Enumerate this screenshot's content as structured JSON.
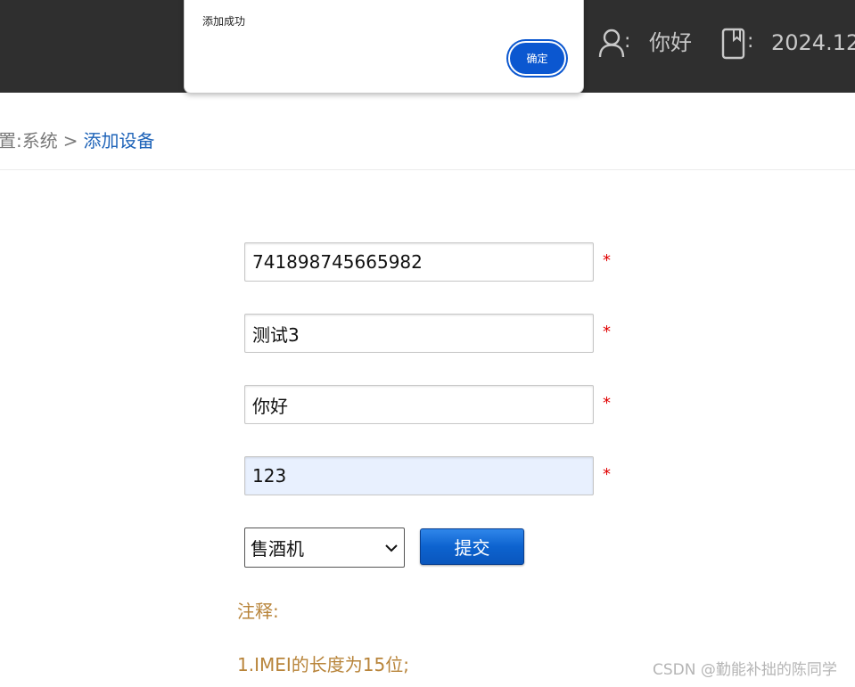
{
  "header": {
    "user_name": "你好",
    "date": "2024.12",
    "colon": ":",
    "user_icon": "user-icon",
    "book_icon": "book-icon",
    "background": "#2f2f2f"
  },
  "alert": {
    "message": "添加成功",
    "ok_label": "确定"
  },
  "breadcrumb": {
    "prefix": "置:",
    "parent": "系统",
    "separator": ">",
    "current": "添加设备"
  },
  "form": {
    "imei_value": "741898745665982",
    "name_value": "测试3",
    "field3_value": "你好",
    "field4_value": "123",
    "required_mark": "*",
    "device_type_selected": "售酒机",
    "submit_label": "提交"
  },
  "notes": {
    "title": "注释:",
    "line1": "1.IMEI的长度为15位;"
  },
  "watermark": "CSDN @勤能补拙的陈同学",
  "colors": {
    "accent": "#0b57d0",
    "link": "#1e63b8",
    "required": "#e00000",
    "note": "#b8843a"
  }
}
